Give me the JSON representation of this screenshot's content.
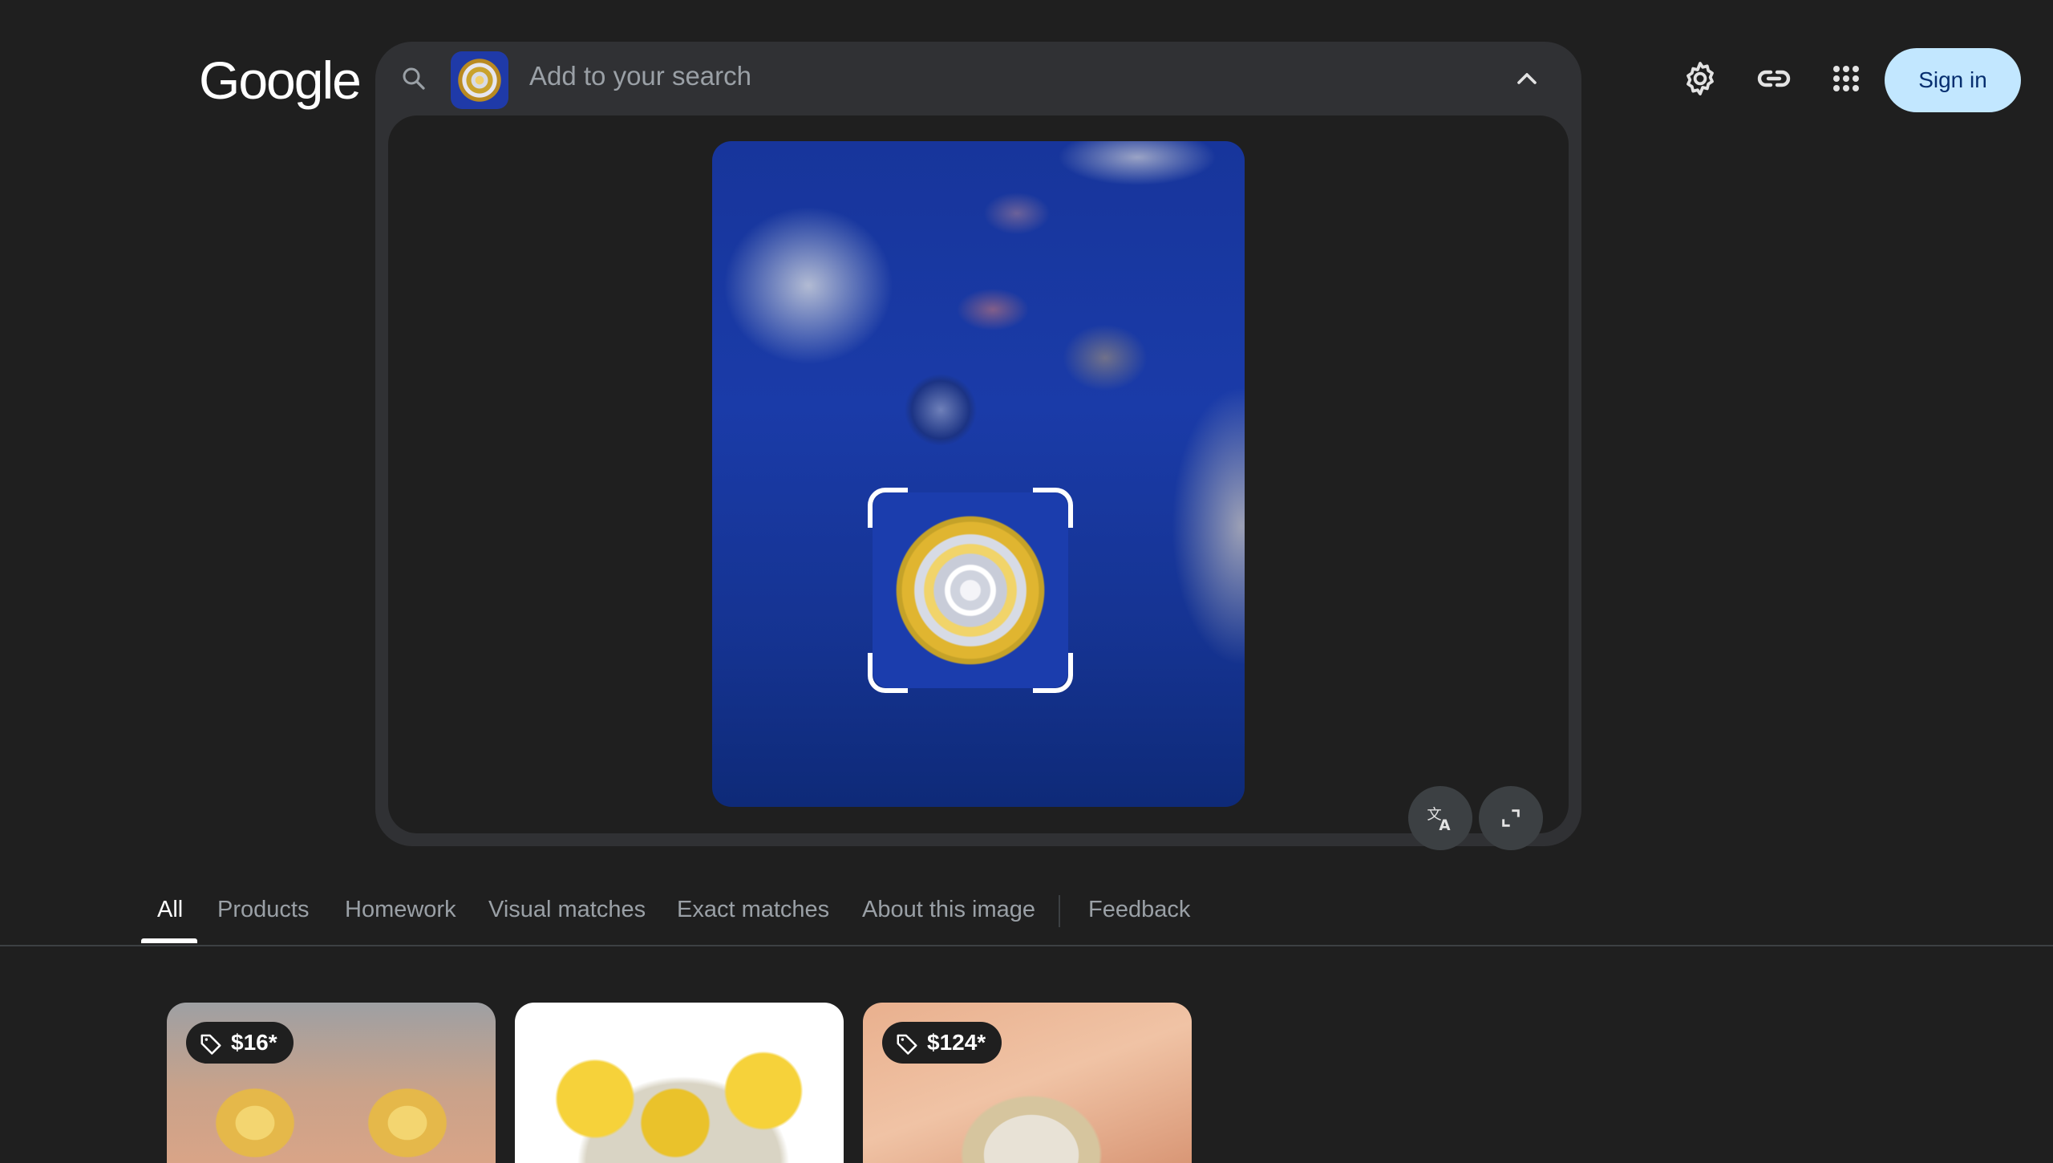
{
  "header": {
    "logo_text": "Google",
    "sign_in_label": "Sign in",
    "icons": [
      "settings-icon",
      "link-icon",
      "apps-icon"
    ]
  },
  "search": {
    "placeholder": "Add to your search",
    "icons": [
      "search-icon",
      "chevron-up-icon"
    ]
  },
  "preview": {
    "buttons": [
      "translate-icon",
      "expand-icon"
    ]
  },
  "tabs": {
    "items": [
      "All",
      "Products",
      "Homework",
      "Visual matches",
      "Exact matches",
      "About this image",
      "Feedback"
    ],
    "active": "All"
  },
  "results": [
    {
      "price": "$16*"
    },
    {
      "price": ""
    },
    {
      "price": "$124*"
    }
  ],
  "colors": {
    "background": "#1f1f1f",
    "panel": "#303134",
    "accent_button": "#c2e7ff",
    "image_blue": "#1a3ba8"
  }
}
